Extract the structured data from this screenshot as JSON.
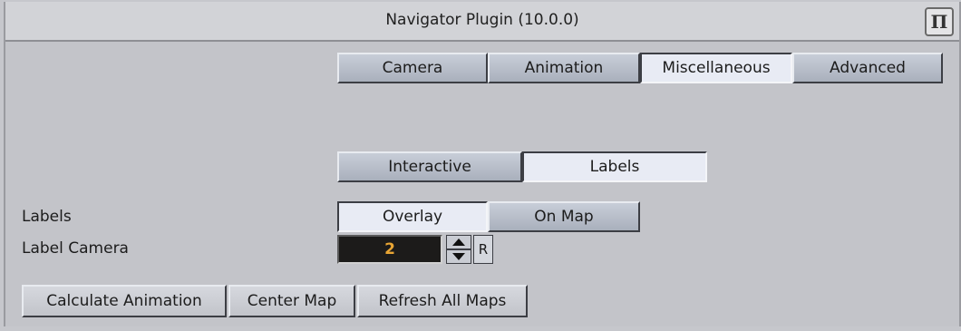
{
  "window": {
    "title": "Navigator Plugin (10.0.0)",
    "logo_glyph": "Π",
    "logo_name": "viz-logo-icon"
  },
  "tabs": [
    {
      "label": "Camera",
      "active": false
    },
    {
      "label": "Animation",
      "active": false
    },
    {
      "label": "Miscellaneous",
      "active": true
    },
    {
      "label": "Advanced",
      "active": false
    }
  ],
  "subtabs": [
    {
      "label": "Interactive",
      "active": false
    },
    {
      "label": "Labels",
      "active": true
    }
  ],
  "labels_row": {
    "label": "Labels",
    "options": [
      {
        "label": "Overlay",
        "active": true
      },
      {
        "label": "On Map",
        "active": false
      }
    ]
  },
  "label_camera": {
    "label": "Label Camera",
    "value": "2",
    "reset_label": "R"
  },
  "actions": {
    "calculate_animation": "Calculate  Animation",
    "center_map": "Center Map",
    "refresh_all_maps": "Refresh All Maps"
  },
  "colors": {
    "background": "#c3c4c9",
    "active_tab": "#e8ebf4",
    "inactive_tab": "#b4bac6",
    "number_field_bg": "#1c1b1a",
    "number_field_text": "#e8a534"
  }
}
